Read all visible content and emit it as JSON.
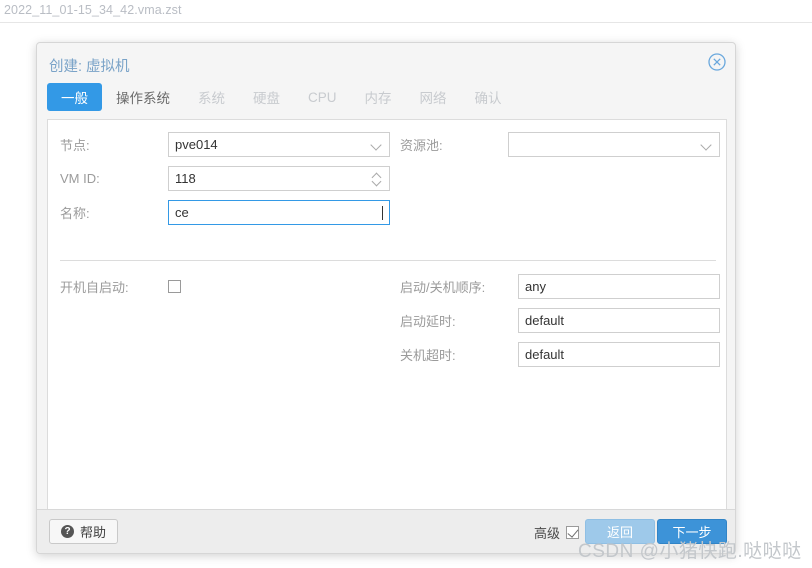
{
  "topbar": {
    "filename": "2022_11_01-15_34_42.vma.zst"
  },
  "dialog": {
    "title": "创建: 虚拟机",
    "close_icon": "close-circle-icon",
    "tabs": [
      {
        "label": "一般",
        "state": "active"
      },
      {
        "label": "操作系统",
        "state": "enabled"
      },
      {
        "label": "系统",
        "state": "disabled"
      },
      {
        "label": "硬盘",
        "state": "disabled"
      },
      {
        "label": "CPU",
        "state": "disabled"
      },
      {
        "label": "内存",
        "state": "disabled"
      },
      {
        "label": "网络",
        "state": "disabled"
      },
      {
        "label": "确认",
        "state": "disabled"
      }
    ],
    "form": {
      "node": {
        "label": "节点:",
        "value": "pve014"
      },
      "vmid": {
        "label": "VM ID:",
        "value": "118"
      },
      "name": {
        "label": "名称:",
        "value": "ce"
      },
      "pool": {
        "label": "资源池:",
        "value": "",
        "placeholder": ""
      },
      "autostart": {
        "label": "开机自启动:",
        "checked": false
      },
      "start_order": {
        "label": "启动/关机顺序:",
        "value": "any"
      },
      "start_delay": {
        "label": "启动延时:",
        "value": "default"
      },
      "shutdown_timeout": {
        "label": "关机超时:",
        "value": "default"
      }
    },
    "footer": {
      "help_label": "帮助",
      "help_icon": "question-circle-icon",
      "advanced_label": "高级",
      "advanced_checked": true,
      "back_label": "返回",
      "next_label": "下一步"
    }
  },
  "watermark": "CSDN @小猪快跑.哒哒哒",
  "colors": {
    "accent": "#3399e6",
    "accent_button": "#3d93d8",
    "accent_disabled": "#9ec9ea",
    "title_text": "#7aa3c8",
    "label_text": "#9b9b9b"
  }
}
